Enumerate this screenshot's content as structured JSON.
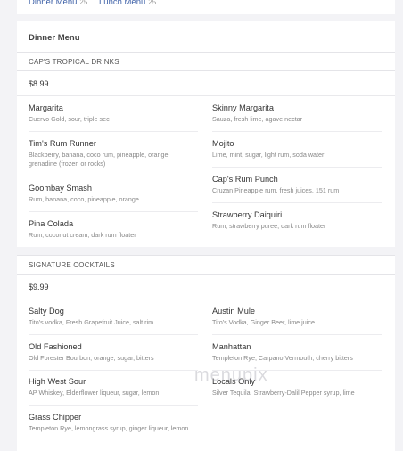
{
  "tabs": [
    {
      "label": "Dinner Menu",
      "count": "25"
    },
    {
      "label": "Lunch Menu",
      "count": "25"
    }
  ],
  "menu_title": "Dinner Menu",
  "sections": [
    {
      "heading": "CAP'S TROPICAL DRINKS",
      "price": "$8.99",
      "items": [
        {
          "name": "Margarita",
          "desc": "Cuervo Gold, sour, triple sec"
        },
        {
          "name": "Skinny Margarita",
          "desc": "Sauza, fresh lime, agave nectar"
        },
        {
          "name": "Tim's Rum Runner",
          "desc": "Blackberry, banana, coco rum, pineapple, orange, grenadine (frozen or rocks)"
        },
        {
          "name": "Mojito",
          "desc": "Lime, mint, sugar, light rum, soda water"
        },
        {
          "name": "Goombay Smash",
          "desc": "Rum, banana, coco, pineapple, orange"
        },
        {
          "name": "Cap's Rum Punch",
          "desc": "Cruzan Pineapple rum, fresh juices, 151 rum"
        },
        {
          "name": "Pina Colada",
          "desc": "Rum, coconut cream, dark rum floater"
        },
        {
          "name": "Strawberry Daiquiri",
          "desc": "Rum, strawberry puree, dark rum floater"
        }
      ]
    },
    {
      "heading": "SIGNATURE COCKTAILS",
      "price": "$9.99",
      "items": [
        {
          "name": "Salty Dog",
          "desc": "Tito's vodka, Fresh Grapefruit Juice, salt rim"
        },
        {
          "name": "Austin Mule",
          "desc": "Tito's Vodka, Ginger Beer, lime juice"
        },
        {
          "name": "Old Fashioned",
          "desc": "Old Forester Bourbon, orange, sugar, bitters"
        },
        {
          "name": "Manhattan",
          "desc": "Templeton Rye, Carpano Vermouth, cherry bitters"
        },
        {
          "name": "High West Sour",
          "desc": "AP Whiskey, Elderflower liqueur, sugar, lemon"
        },
        {
          "name": "Locals Only",
          "desc": "Silver Tequila, Strawberry-Dalil Pepper syrup, lime"
        },
        {
          "name": "Grass Chipper",
          "desc": "Templeton Rye, lemongrass syrup, ginger liqueur, lemon"
        }
      ]
    }
  ],
  "watermark": "menupix",
  "colors": {
    "link": "#3f62a8",
    "background": "#f3f3f6"
  }
}
